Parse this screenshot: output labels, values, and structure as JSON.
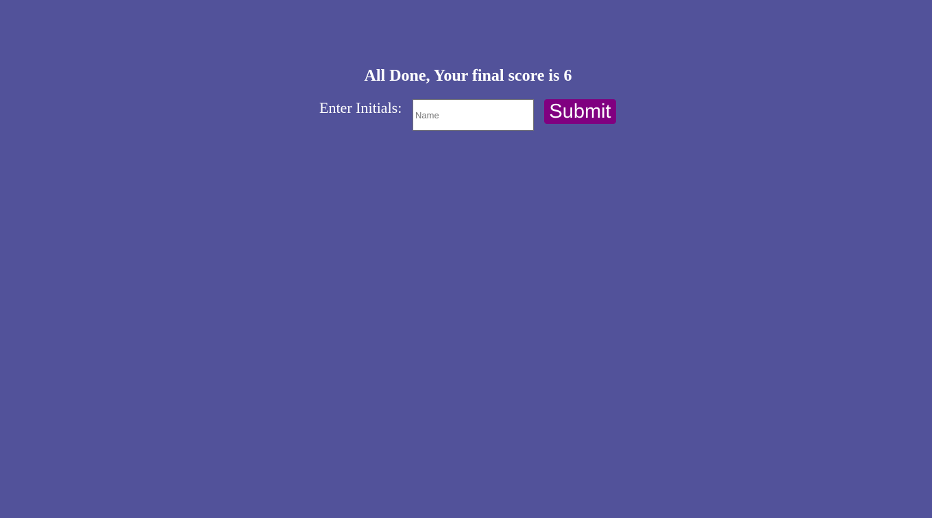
{
  "final_screen": {
    "title": "All Done, Your final score is 6",
    "initials_label": "Enter Initials:",
    "initials_input": {
      "placeholder": "Name",
      "value": ""
    },
    "submit_label": "Submit"
  },
  "colors": {
    "background": "#52529a",
    "text": "#ffffff",
    "submit_button": "#800080"
  }
}
